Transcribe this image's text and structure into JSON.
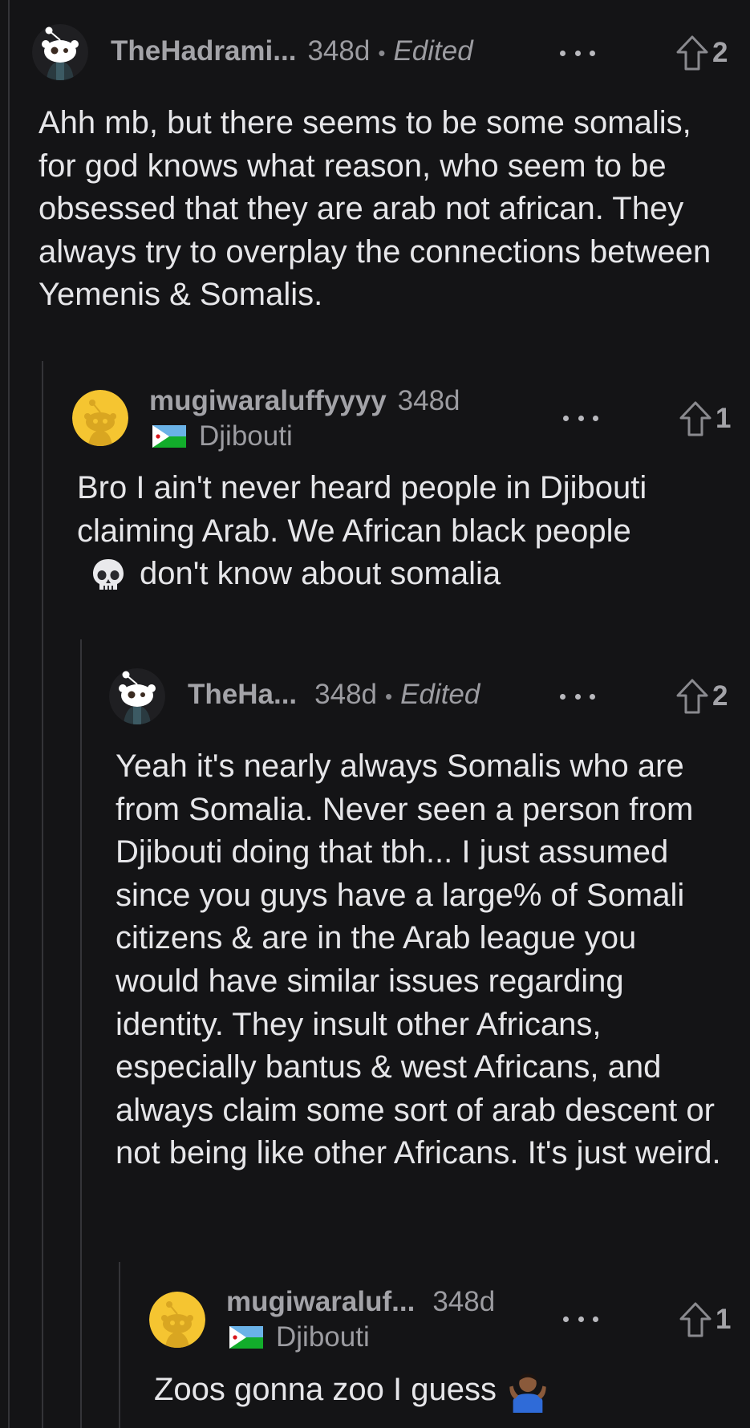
{
  "comments": [
    {
      "username": "TheHadrami...",
      "age": "348d",
      "edited_separator": "•",
      "edited": "Edited",
      "votes": "2",
      "avatar": "snoo-avatar-dark",
      "text": "Ahh mb, but there seems to be some somalis, for god knows what reason, who seem to be obsessed that they are arab not african. They always try to overplay the connections between Yemenis & Somalis."
    },
    {
      "username": "mugiwaraluffyyyy",
      "age": "348d",
      "flair": "Djibouti",
      "votes": "1",
      "avatar": "snoo-avatar-yellow",
      "text_before_emoji": "Bro I ain't never heard people in Djibouti claiming Arab. We African black people",
      "emoji": "skull-emoji",
      "text_after_emoji": "don't know about somalia"
    },
    {
      "username": "TheHa...",
      "age": "348d",
      "edited_separator": "•",
      "edited": "Edited",
      "votes": "2",
      "avatar": "snoo-avatar-dark",
      "text": "Yeah it's nearly always Somalis who are from Somalia. Never seen a person from Djibouti doing that tbh... I just assumed since you guys have a large% of Somali citizens & are in the Arab league you would have similar issues regarding identity. They insult other Africans, especially bantus & west Africans, and always claim some sort of arab descent or not being like other Africans. It's just weird."
    },
    {
      "username": "mugiwaraluf...",
      "age": "348d",
      "flair": "Djibouti",
      "votes": "1",
      "avatar": "snoo-avatar-yellow",
      "text": "Zoos gonna zoo I guess",
      "emoji": "person-shrugging-emoji"
    }
  ],
  "icons": {
    "more": "more-options-icon",
    "upvote": "upvote-arrow-icon",
    "flag": "djibouti-flag-icon"
  },
  "colors": {
    "background": "#141416",
    "thread_line": "#343438",
    "text": "#e6e6e9",
    "muted": "#9c9ca1",
    "avatar_yellow": "#f5c531"
  }
}
